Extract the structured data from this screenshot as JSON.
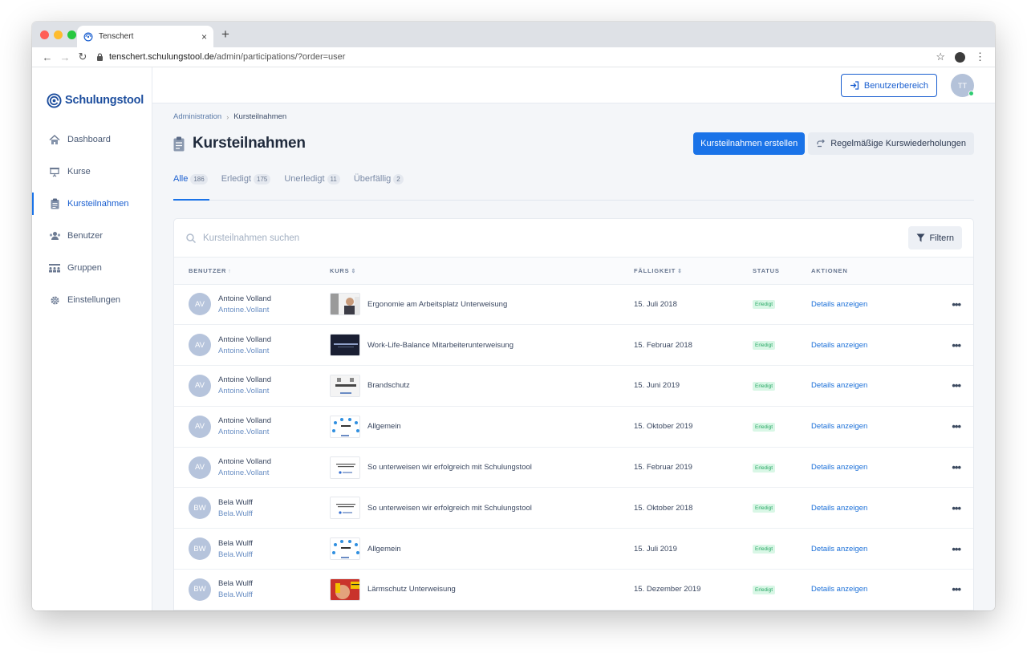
{
  "browser": {
    "tab_title": "Tenschert",
    "tab_close": "×",
    "new_tab": "+",
    "back": "←",
    "forward": "→",
    "reload": "↻",
    "url_host": "tenschert.schulungstool.de",
    "url_path": "/admin/participations/?order=user",
    "star": "☆",
    "menu": "⋮"
  },
  "sidebar": {
    "logo_text": "Schulungstool",
    "items": [
      {
        "label": "Dashboard",
        "icon": "home-icon"
      },
      {
        "label": "Kurse",
        "icon": "presentation-icon"
      },
      {
        "label": "Kursteilnahmen",
        "icon": "clipboard-icon",
        "active": true
      },
      {
        "label": "Benutzer",
        "icon": "users-icon"
      },
      {
        "label": "Gruppen",
        "icon": "groups-icon"
      },
      {
        "label": "Einstellungen",
        "icon": "gear-icon"
      }
    ]
  },
  "topbar": {
    "user_area_label": "Benutzerbereich",
    "avatar_initials": "TT"
  },
  "breadcrumb": {
    "root": "Administration",
    "separator": "›",
    "current": "Kursteilnahmen"
  },
  "page": {
    "title": "Kursteilnahmen",
    "create_label": "Kursteilnahmen erstellen",
    "recurring_label": "Regelmäßige Kurswiederholungen"
  },
  "tabs": [
    {
      "label": "Alle",
      "count": "186",
      "active": true
    },
    {
      "label": "Erledigt",
      "count": "175"
    },
    {
      "label": "Unerledigt",
      "count": "11"
    },
    {
      "label": "Überfällig",
      "count": "2"
    }
  ],
  "search": {
    "placeholder": "Kursteilnahmen suchen",
    "filter_label": "Filtern"
  },
  "table": {
    "headers": {
      "user": "BENUTZER",
      "course": "KURS",
      "due": "FÄLLIGKEIT",
      "status": "STATUS",
      "actions": "AKTIONEN"
    },
    "sort_both": "⇕",
    "sort_up": "↑",
    "rows": [
      {
        "initials": "AV",
        "name": "Antoine Volland",
        "login": "Antoine.Vollant",
        "course": "Ergonomie am Arbeitsplatz Unterweisung",
        "thumb": "ergonomie",
        "due": "15. Juli 2018",
        "status": "Erledigt",
        "action": "Details anzeigen"
      },
      {
        "initials": "AV",
        "name": "Antoine Volland",
        "login": "Antoine.Vollant",
        "course": "Work-Life-Balance Mitarbeiterunterweisung",
        "thumb": "worklife",
        "due": "15. Februar 2018",
        "status": "Erledigt",
        "action": "Details anzeigen"
      },
      {
        "initials": "AV",
        "name": "Antoine Volland",
        "login": "Antoine.Vollant",
        "course": "Brandschutz",
        "thumb": "brandschutz",
        "due": "15. Juni 2019",
        "status": "Erledigt",
        "action": "Details anzeigen"
      },
      {
        "initials": "AV",
        "name": "Antoine Volland",
        "login": "Antoine.Vollant",
        "course": "Allgemein",
        "thumb": "allgemein",
        "due": "15. Oktober 2019",
        "status": "Erledigt",
        "action": "Details anzeigen"
      },
      {
        "initials": "AV",
        "name": "Antoine Volland",
        "login": "Antoine.Vollant",
        "course": "So unterweisen wir erfolgreich mit Schulungstool",
        "thumb": "sounterweisen",
        "due": "15. Februar 2019",
        "status": "Erledigt",
        "action": "Details anzeigen"
      },
      {
        "initials": "BW",
        "name": "Bela Wulff",
        "login": "Bela.Wulff",
        "course": "So unterweisen wir erfolgreich mit Schulungstool",
        "thumb": "sounterweisen",
        "due": "15. Oktober 2018",
        "status": "Erledigt",
        "action": "Details anzeigen"
      },
      {
        "initials": "BW",
        "name": "Bela Wulff",
        "login": "Bela.Wulff",
        "course": "Allgemein",
        "thumb": "allgemein",
        "due": "15. Juli 2019",
        "status": "Erledigt",
        "action": "Details anzeigen"
      },
      {
        "initials": "BW",
        "name": "Bela Wulff",
        "login": "Bela.Wulff",
        "course": "Lärmschutz Unterweisung",
        "thumb": "laermschutz",
        "due": "15. Dezember 2019",
        "status": "Erledigt",
        "action": "Details anzeigen"
      }
    ],
    "more_label": "•••"
  },
  "colors": {
    "primary": "#1a73e8",
    "success_bg": "#d9f7e6",
    "success_text": "#2aa866",
    "avatar_bg": "#b6c4dc"
  }
}
